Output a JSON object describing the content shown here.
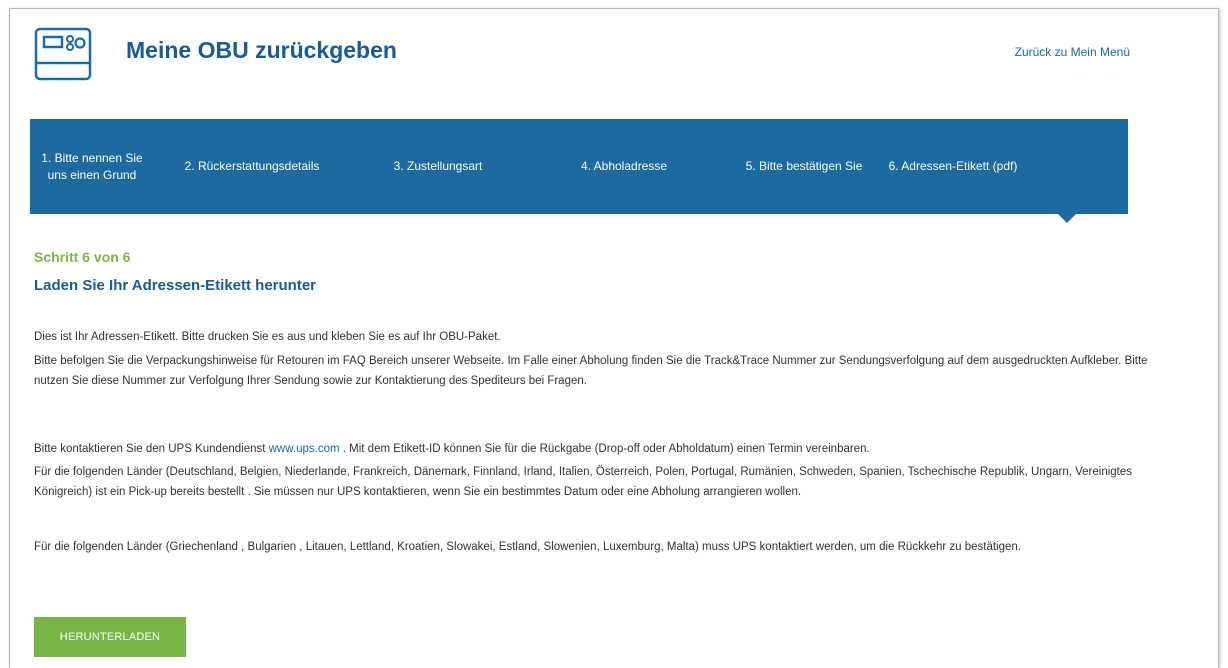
{
  "header": {
    "title": "Meine OBU zurückgeben",
    "back_link": "Zurück zu Mein Menü",
    "logo_icon": "obu-device-icon"
  },
  "steps": [
    {
      "label": "1. Bitte nennen Sie uns einen Grund"
    },
    {
      "label": "2. Rückerstattungsdetails"
    },
    {
      "label": "3. Zustellungsart"
    },
    {
      "label": "4. Abholadresse"
    },
    {
      "label": "5. Bitte bestätigen Sie"
    },
    {
      "label": "6. Adressen-Etikett (pdf)"
    }
  ],
  "active_step": 6,
  "content": {
    "step_counter": "Schritt 6 von 6",
    "heading": "Laden Sie Ihr Adressen-Etikett herunter",
    "p1": "Dies ist Ihr Adressen-Etikett. Bitte drucken Sie es aus und kleben Sie es auf Ihr OBU-Paket.",
    "p2": "Bitte befolgen Sie die Verpackungshinweise für Retouren im FAQ Bereich unserer Webseite. Im Falle einer Abholung finden Sie die Track&Trace Nummer zur Sendungsverfolgung auf dem ausgedruckten Aufkleber. Bitte nutzen Sie diese Nummer zur Verfolgung Ihrer Sendung sowie zur Kontaktierung des Spediteurs bei Fragen.",
    "p3_before": "Bitte kontaktieren Sie den UPS Kundendienst ",
    "p3_link": "www.ups.com",
    "p3_after": " . Mit dem Etikett-ID können Sie für die Rückgabe (Drop-off oder Abholdatum) einen Termin vereinbaren.",
    "p4": "Für die folgenden Länder (Deutschland, Belgien, Niederlande, Frankreich, Dänemark, Finnland, Irland, Italien, Österreich, Polen, Portugal, Rumänien, Schweden, Spanien, Tschechische Republik, Ungarn, Vereinigtes Königreich) ist ein Pick-up bereits bestellt . Sie müssen nur UPS kontaktieren, wenn Sie ein bestimmtes Datum oder eine Abholung arrangieren wollen.",
    "p5": "Für die folgenden Länder (Griechenland , Bulgarien , Litauen, Lettland, Kroatien, Slowakei, Estland, Slowenien, Luxemburg, Malta) muss UPS kontaktiert werden, um die Rückkehr zu bestätigen."
  },
  "download_button": "HERUNTERLADEN",
  "colors": {
    "primary_blue": "#1c6aa0",
    "title_blue": "#1a5a96",
    "accent_green": "#79b546"
  }
}
